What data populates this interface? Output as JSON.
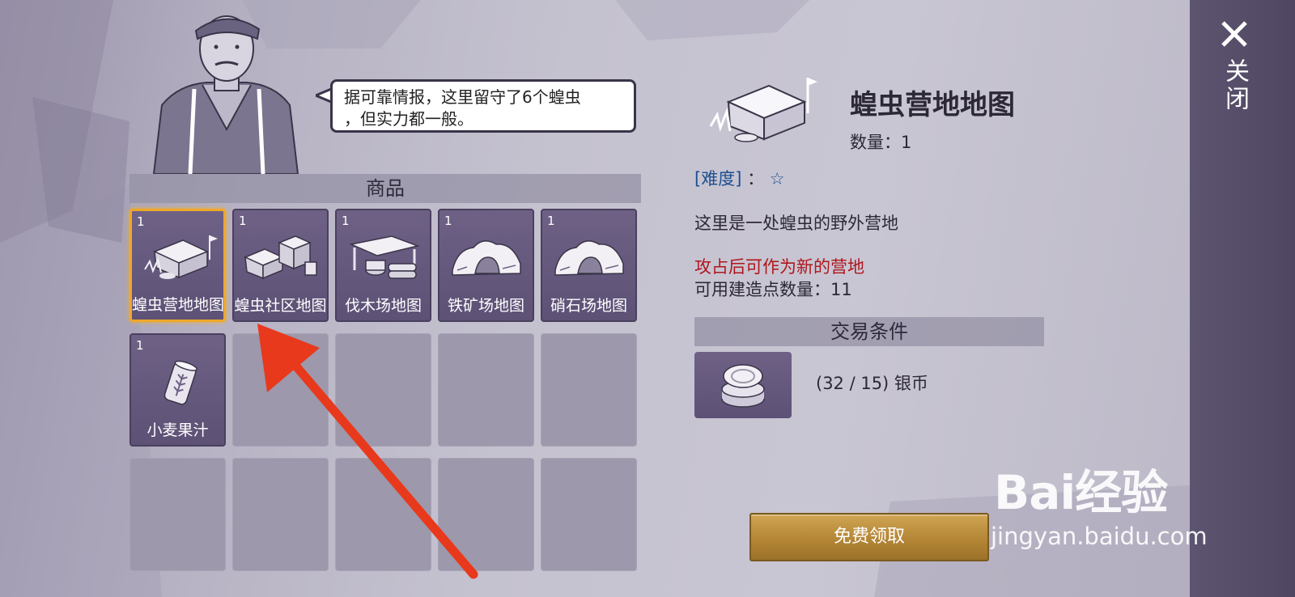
{
  "npc": {
    "dialogue_line1": "据可靠情报，这里留守了6个蝗虫",
    "dialogue_line2": "，但实力都一般。"
  },
  "shop": {
    "section_title": "商品",
    "items": [
      {
        "qty": "1",
        "name": "蝗虫营地地图",
        "icon": "camp-map-icon",
        "selected": true
      },
      {
        "qty": "1",
        "name": "蝗虫社区地图",
        "icon": "community-map-icon",
        "selected": false
      },
      {
        "qty": "1",
        "name": "伐木场地图",
        "icon": "lumberyard-map-icon",
        "selected": false
      },
      {
        "qty": "1",
        "name": "铁矿场地图",
        "icon": "iron-mine-map-icon",
        "selected": false
      },
      {
        "qty": "1",
        "name": "硝石场地图",
        "icon": "saltpeter-map-icon",
        "selected": false
      },
      {
        "qty": "1",
        "name": "小麦果汁",
        "icon": "wheat-juice-can-icon",
        "selected": false
      }
    ]
  },
  "detail": {
    "title": "蝗虫营地地图",
    "quantity_label": "数量：",
    "quantity_value": "1",
    "difficulty_label": "[难度]",
    "difficulty_sep": "：",
    "difficulty_stars": "☆",
    "description": "这里是一处蝗虫的野外营地",
    "highlight": "攻占后可作为新的营地",
    "build_points_label": "可用建造点数量：",
    "build_points_value": "11",
    "trade_title": "交易条件",
    "cost_text": "(32 / 15) 银币",
    "claim_button": "免费领取"
  },
  "close": {
    "label": "关闭"
  },
  "watermark": {
    "logo": "Bai经验",
    "url": "jingyan.baidu.com"
  },
  "colors": {
    "accent_gold": "#cfa552",
    "slot_purple": "#6e6185",
    "highlight_red": "#b0161c",
    "link_blue": "#1c4f90",
    "selection_orange": "#f0a72a",
    "arrow_red": "#e8391c"
  }
}
